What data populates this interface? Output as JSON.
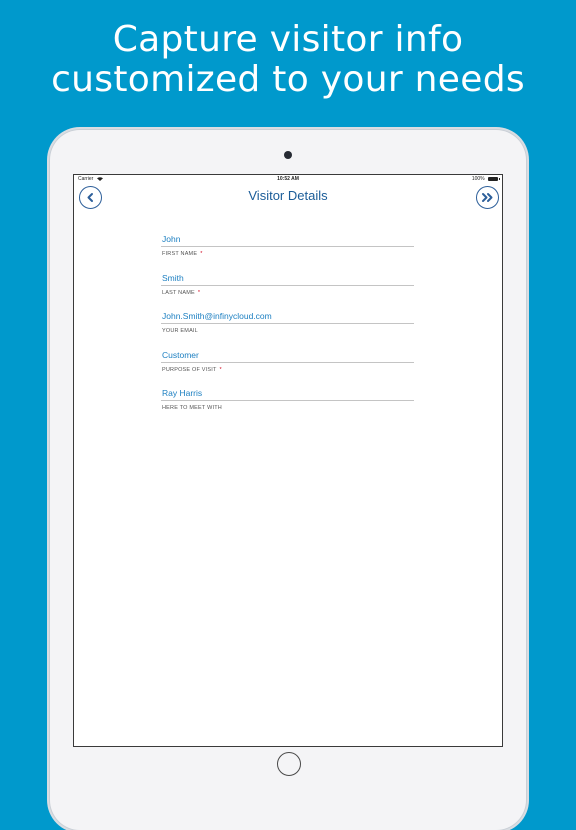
{
  "promo": {
    "line1": "Capture visitor info",
    "line2": "customized to your needs"
  },
  "statusbar": {
    "carrier": "Carrier",
    "time": "10:52 AM",
    "battery": "100%"
  },
  "navbar": {
    "title": "Visitor Details",
    "back_icon": "chevron-left-icon",
    "next_icon": "double-chevron-right-icon"
  },
  "form": {
    "fields": [
      {
        "value": "John",
        "label": "FIRST NAME",
        "required": "*"
      },
      {
        "value": "Smith",
        "label": "LAST NAME",
        "required": "*"
      },
      {
        "value": "John.Smith@infinycloud.com",
        "label": "YOUR EMAIL",
        "required": ""
      },
      {
        "value": "Customer",
        "label": "PURPOSE OF VISIT",
        "required": "*"
      },
      {
        "value": "Ray Harris",
        "label": "HERE TO MEET WITH",
        "required": ""
      }
    ]
  },
  "colors": {
    "background": "#0099cc",
    "accent": "#1c7fc1",
    "nav": "#2d5f9a",
    "required": "#d0021b"
  }
}
